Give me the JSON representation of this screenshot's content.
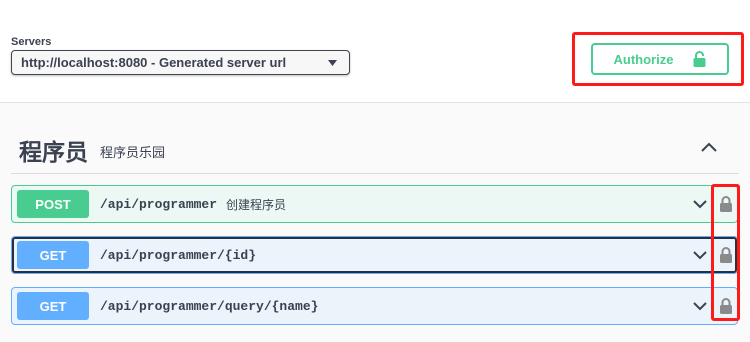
{
  "servers": {
    "label": "Servers",
    "selected": "http://localhost:8080 - Generated server url"
  },
  "authorize": {
    "label": "Authorize",
    "icon": "unlocked-lock-icon",
    "color": "#49cc90"
  },
  "tag": {
    "name": "程序员",
    "description": "程序员乐园",
    "expanded": true
  },
  "operations": [
    {
      "method": "POST",
      "path": "/api/programmer",
      "summary": "创建程序员",
      "color": "#49cc90"
    },
    {
      "method": "GET",
      "path": "/api/programmer/{id}",
      "summary": "",
      "color": "#61affe"
    },
    {
      "method": "GET",
      "path": "/api/programmer/query/{name}",
      "summary": "",
      "color": "#61affe"
    }
  ],
  "annotations": {
    "highlight_color": "#ff1a1a"
  }
}
